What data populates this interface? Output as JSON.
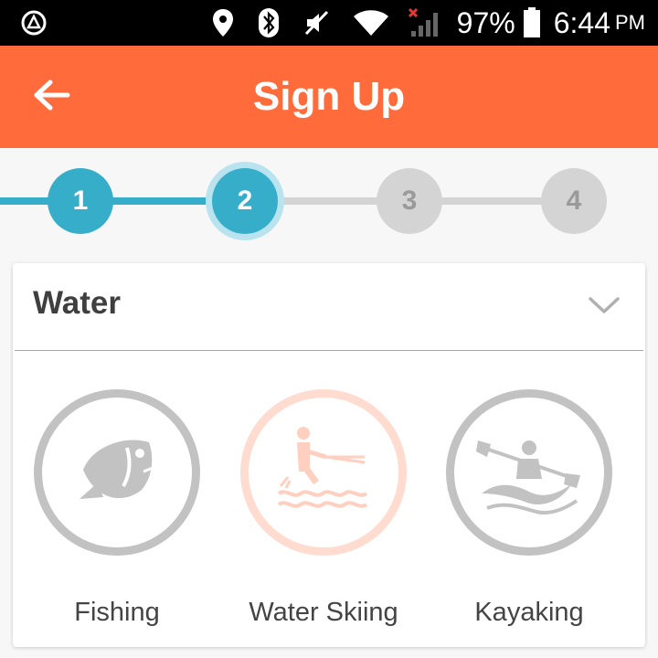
{
  "status_bar": {
    "battery": "97%",
    "time": "6:44",
    "ampm": "PM",
    "icons": [
      "android-nav-icon",
      "location-icon",
      "bluetooth-icon",
      "mute-icon",
      "wifi-icon",
      "signal-icon",
      "battery-icon"
    ]
  },
  "header": {
    "title": "Sign Up",
    "background": "#ff6b3a",
    "back_icon": "arrow-left-icon"
  },
  "stepper": {
    "current": 2,
    "steps": [
      {
        "label": "1",
        "state": "completed"
      },
      {
        "label": "2",
        "state": "current"
      },
      {
        "label": "3",
        "state": "pending"
      },
      {
        "label": "4",
        "state": "pending"
      }
    ],
    "active_color": "#36adc9",
    "inactive_color": "#d4d4d4"
  },
  "card": {
    "title": "Water",
    "expand_icon": "chevron-down-icon",
    "activities": [
      {
        "label": "Fishing",
        "icon": "fish-icon",
        "selected": false
      },
      {
        "label": "Water Skiing",
        "icon": "water-skiing-icon",
        "selected": true
      },
      {
        "label": "Kayaking",
        "icon": "kayaking-icon",
        "selected": false
      }
    ]
  }
}
